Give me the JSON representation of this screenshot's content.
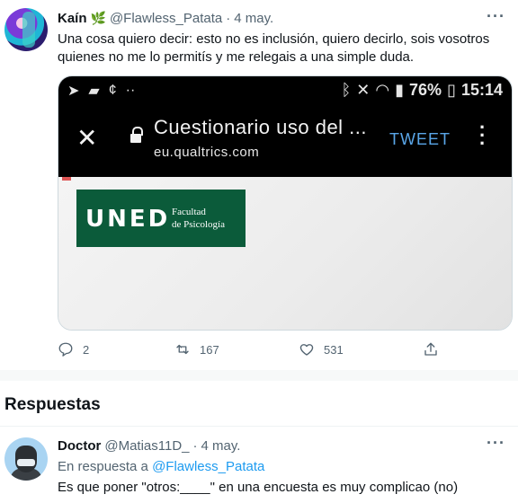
{
  "tweet": {
    "name": "Kaín",
    "handle": "@Flawless_Patata",
    "separator": "·",
    "date": "4 may.",
    "text": "Una cosa quiero decir: esto no es inclusión, quiero decirlo, sois vosotros quienes no me lo permitís y me relegais a una simple duda.",
    "more_icon": "more-horizontal-icon",
    "media": {
      "statusbar": {
        "battery": "76%",
        "time": "15:14"
      },
      "page_title": "Cuestionario uso del ...",
      "page_url": "eu.qualtrics.com",
      "tweet_button": "TWEET",
      "logo": {
        "word": "UNED",
        "faculty_line1": "Facultad",
        "faculty_line2": "de Psicología",
        "color": "#0b5b3a"
      }
    },
    "actions": {
      "replies": "2",
      "retweets": "167",
      "likes": "531"
    }
  },
  "section_title": "Respuestas",
  "reply": {
    "name": "Doctor",
    "handle": "@Matias11D_",
    "separator": "·",
    "date": "4 may.",
    "reply_prefix": "En respuesta a",
    "reply_to": "@Flawless_Patata",
    "text": "Es que poner \"otros:____\" en una encuesta  es muy complicao (no)"
  },
  "colors": {
    "accent": "#1d9bf0",
    "muted": "#536471"
  }
}
